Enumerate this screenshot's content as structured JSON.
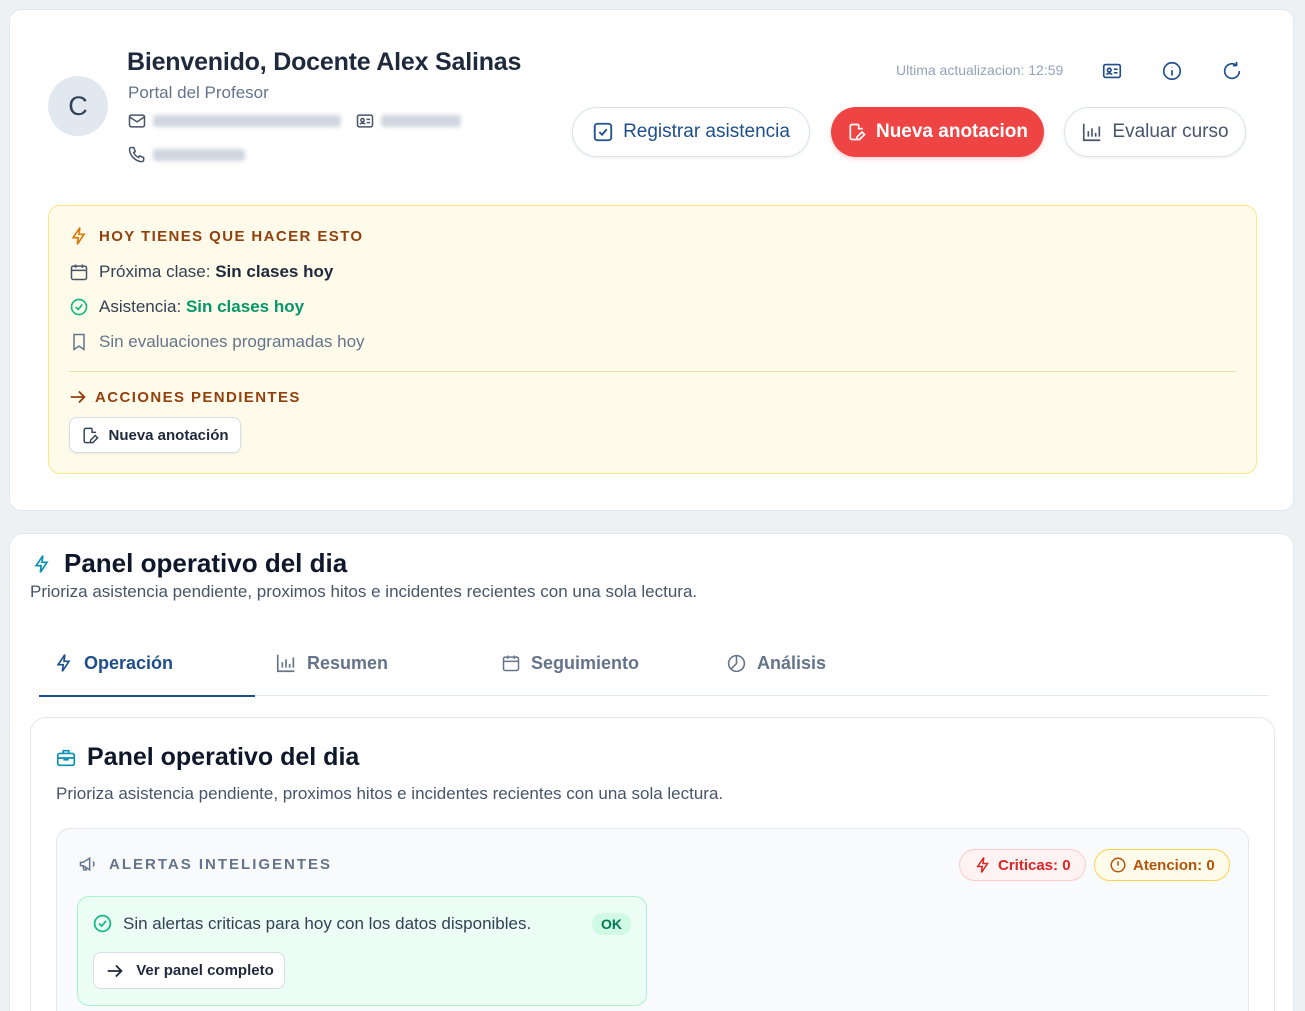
{
  "header": {
    "avatar_initial": "C",
    "welcome": "Bienvenido, Docente Alex Salinas",
    "subtitle": "Portal del Profesor",
    "updated": "Ultima actualizacion: 12:59",
    "icons": [
      "id-card-icon",
      "info-icon",
      "refresh-icon"
    ]
  },
  "actions": {
    "register_attendance": "Registrar asistencia",
    "new_note": "Nueva anotacion",
    "evaluate_course": "Evaluar curso"
  },
  "todo": {
    "title": "HOY TIENES QUE HACER ESTO",
    "next_class_label": "Próxima clase:",
    "next_class_value": "Sin clases hoy",
    "attendance_label": "Asistencia:",
    "attendance_value": "Sin clases hoy",
    "evaluations": "Sin evaluaciones programadas hoy",
    "pending_title": "ACCIONES PENDIENTES",
    "pending_button": "Nueva anotación"
  },
  "panel": {
    "title": "Panel operativo del dia",
    "subtitle": "Prioriza asistencia pendiente, proximos hitos e incidentes recientes con una sola lectura.",
    "tabs": [
      {
        "label": "Operación",
        "icon": "bolt-icon",
        "active": true
      },
      {
        "label": "Resumen",
        "icon": "bar-chart-icon",
        "active": false
      },
      {
        "label": "Seguimiento",
        "icon": "calendar-icon",
        "active": false
      },
      {
        "label": "Análisis",
        "icon": "pie-chart-icon",
        "active": false
      }
    ]
  },
  "operation": {
    "title": "Panel operativo del dia",
    "subtitle": "Prioriza asistencia pendiente, proximos hitos e incidentes recientes con una sola lectura.",
    "alerts_title": "ALERTAS INTELIGENTES",
    "critical": "Criticas: 0",
    "attention": "Atencion: 0",
    "ok_message": "Sin alertas criticas para hoy con los datos disponibles.",
    "ok_badge": "OK",
    "full_panel": "Ver panel completo"
  },
  "colors": {
    "accent_blue": "#1e4f8a",
    "danger_red": "#ef4444",
    "warning_bg": "#fffbeb",
    "success_green": "#059669"
  }
}
